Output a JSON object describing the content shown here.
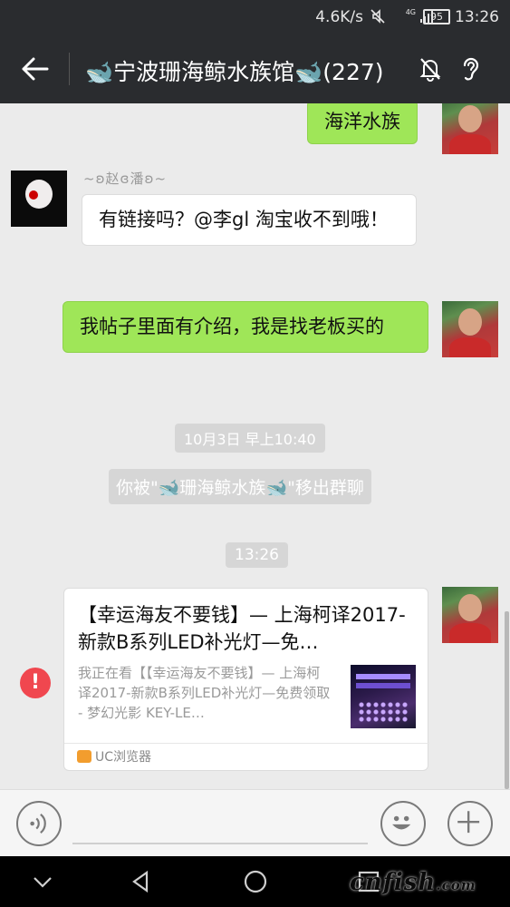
{
  "status_bar": {
    "net_speed": "4.6K/s",
    "network": "4G",
    "battery": "95",
    "time": "13:26"
  },
  "title_bar": {
    "back_icon": "arrow-left-icon",
    "group_emoji": "whale",
    "group_name": "宁波珊海鲸水族馆",
    "member_count": "(227)",
    "mute_icon": "bell-off-icon",
    "earpiece_icon": "ear-icon"
  },
  "messages": [
    {
      "type": "text",
      "from": "me",
      "text": "海洋水族"
    },
    {
      "type": "text",
      "from": "other",
      "sender": "~ʚ赵ɞ潘ʚ~",
      "text": "有链接吗？@李gl  淘宝收不到哦！"
    },
    {
      "type": "text",
      "from": "me",
      "text": "我帖子里面有介绍，我是找老板买的"
    },
    {
      "type": "time",
      "text": "10月3日 早上10:40"
    },
    {
      "type": "system",
      "text_before": "你被\"",
      "text_middle": "珊海鲸水族",
      "text_after": "\"移出群聊"
    },
    {
      "type": "time",
      "text": "13:26"
    },
    {
      "type": "link_card",
      "from": "me",
      "failed": true,
      "error_mark": "!",
      "title": "【幸运海友不要钱】— 上海柯译2017-新款B系列LED补光灯—免…",
      "description": "我正在看【【幸运海友不要钱】— 上海柯译2017-新款B系列LED补光灯—免费领取 - 梦幻光影 KEY-LE…",
      "source": "UC浏览器"
    }
  ],
  "input_bar": {
    "voice_icon": "voice-icon",
    "emoji_icon": "smiley-icon",
    "plus_icon": "plus-icon"
  },
  "nav_bar": {
    "watermark_main": "cnfish",
    "watermark_suffix": ".com"
  },
  "colors": {
    "bar_bg": "#2a2c2f",
    "chat_bg": "#ebebeb",
    "bubble_green": "#9fe658",
    "error_red": "#f0474f"
  }
}
